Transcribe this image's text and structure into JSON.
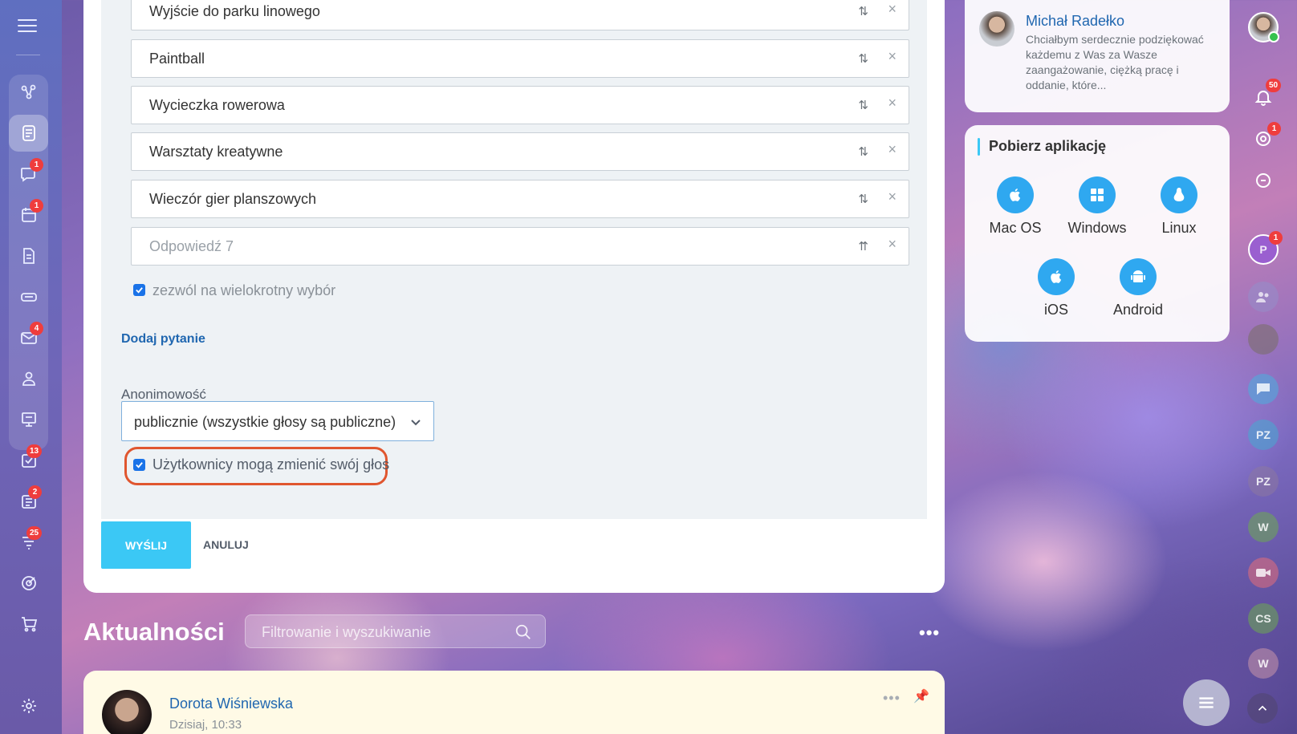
{
  "left_nav": {
    "badges": {
      "chat": "1",
      "calendar": "1",
      "mail": "4",
      "tasks": "13",
      "news": "2",
      "filter": "25"
    }
  },
  "poll": {
    "answers": [
      {
        "text": "Wyjście do parku linowego",
        "placeholder": false
      },
      {
        "text": "Paintball",
        "placeholder": false
      },
      {
        "text": "Wycieczka rowerowa",
        "placeholder": false
      },
      {
        "text": "Warsztaty kreatywne",
        "placeholder": false
      },
      {
        "text": "Wieczór gier planszowych",
        "placeholder": false
      },
      {
        "text": "Odpowiedź 7",
        "placeholder": true
      }
    ],
    "sort_glyph": "⇅",
    "sort_glyph_new": "⇈",
    "delete_glyph": "×",
    "multiple_choice_label": "zezwól na wielokrotny wybór",
    "multiple_choice_checked": true,
    "add_question_label": "Dodaj pytanie",
    "anonymity_label": "Anonimowość",
    "anonymity_value": "publicznie (wszystkie głosy są publiczne)",
    "change_vote_label": "Użytkownicy mogą zmienić swój głos",
    "change_vote_checked": true
  },
  "buttons": {
    "send": "WYŚLIJ",
    "cancel": "ANULUJ"
  },
  "feed": {
    "title": "Aktualności",
    "search_placeholder": "Filtrowanie i wyszukiwanie",
    "more": "•••"
  },
  "post": {
    "author": "Dorota Wiśniewska",
    "time": "Dzisiaj, 10:33",
    "more": "•••"
  },
  "gratitude": {
    "name": "Michał Radełko",
    "message": "Chciałbym serdecznie podziękować każdemu z Was za Wasze zaangażowanie, ciężką pracę i oddanie, które..."
  },
  "apps": {
    "title": "Pobierz aplikację",
    "items": [
      {
        "label": "Mac OS",
        "icon": "apple-icon"
      },
      {
        "label": "Windows",
        "icon": "windows-icon"
      },
      {
        "label": "Linux",
        "icon": "linux-icon"
      },
      {
        "label": "iOS",
        "icon": "apple-icon"
      },
      {
        "label": "Android",
        "icon": "android-icon"
      }
    ]
  },
  "right_rail": {
    "notifications_badge": "50",
    "goals_badge": "1",
    "chat_p_badge": "1",
    "chat_p_initial": "P",
    "chats": [
      "PZ",
      "PZ",
      "W",
      "CS",
      "W"
    ]
  },
  "colors": {
    "accent": "#3bc8f5",
    "link": "#2067b0",
    "badge": "#ef3d3d",
    "highlight": "#e0562f",
    "checkbox": "#1a73e8"
  }
}
